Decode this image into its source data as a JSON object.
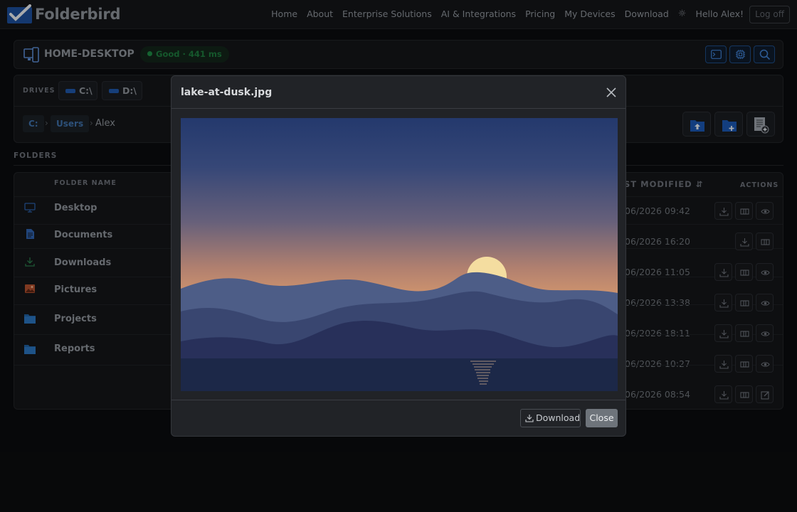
{
  "app": {
    "name": "Folderbird",
    "nav": [
      "Home",
      "About",
      "Enterprise Solutions",
      "AI & Integrations",
      "Pricing",
      "My Devices",
      "Download"
    ],
    "greeting": "Hello Alex!",
    "logoff": "Log off",
    "theme_icon": "sun-icon"
  },
  "device": {
    "name": "HOME-DESKTOP",
    "status": "Good · 441 ms",
    "status_color": "#1e8a44",
    "tools": [
      "terminal-icon",
      "chip-icon",
      "search-icon"
    ]
  },
  "drives": {
    "label": "DRIVES",
    "items": [
      "C:\\",
      "D:\\"
    ]
  },
  "breadcrumb": {
    "root": "C:",
    "sep": "›",
    "users": "Users",
    "current": "Alex"
  },
  "actions": [
    "upload-icon",
    "new-folder-icon",
    "new-file-icon"
  ],
  "folders": {
    "section": "FOLDERS",
    "headers": {
      "name": "FOLDER NAME",
      "modified": "ST MODIFIED",
      "actions": "ACTIONS"
    },
    "rows": [
      {
        "name": "Desktop",
        "modified": "06/2026 09:42",
        "icon": "monitor-icon",
        "icon_color": "#2a5fa8"
      },
      {
        "name": "Documents",
        "modified": "06/2026 16:20",
        "icon": "document-icon",
        "icon_color": "#2f62ad"
      },
      {
        "name": "Downloads",
        "modified": "06/2026 11:05",
        "icon": "download-icon",
        "icon_color": "#2a7a4a"
      },
      {
        "name": "Pictures",
        "modified": "06/2026 13:38",
        "icon": "picture-icon",
        "icon_color": "#b0502e"
      },
      {
        "name": "Projects",
        "modified": "06/2026 18:11",
        "icon": "folder-icon",
        "icon_color": "#1f5f9e"
      },
      {
        "name": "Reports",
        "modified": "06/2026 10:27",
        "icon": "folder-icon",
        "icon_color": "#1f5f9e"
      },
      {
        "name": "",
        "modified": "06/2026 08:54",
        "icon": "",
        "icon_color": ""
      }
    ]
  },
  "modal": {
    "title": "lake-at-dusk.jpg",
    "download": "Download",
    "close": "Close"
  }
}
